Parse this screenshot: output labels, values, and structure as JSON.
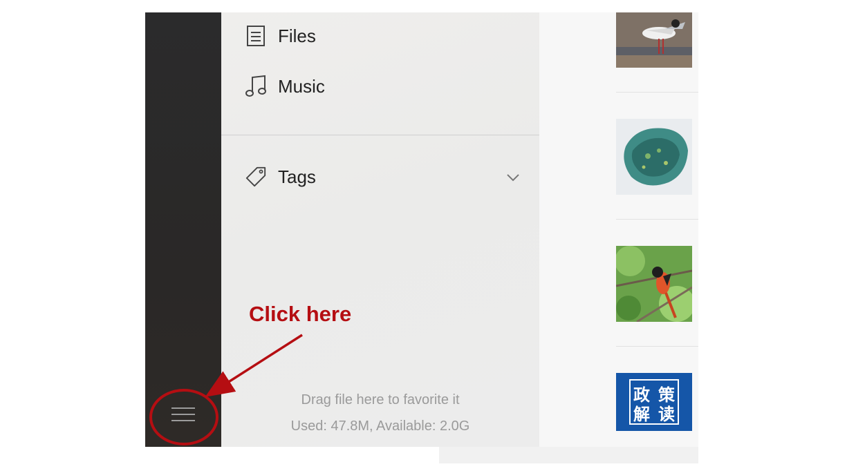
{
  "sidebar": {
    "menu_button_icon": "hamburger-icon"
  },
  "nav": {
    "items": [
      {
        "label": "Files",
        "icon": "document-icon"
      },
      {
        "label": "Music",
        "icon": "music-note-icon"
      }
    ],
    "tags": {
      "label": "Tags",
      "icon": "tag-icon",
      "expand_icon": "chevron-down-icon"
    }
  },
  "footer": {
    "hint": "Drag file here to favorite it",
    "storage": "Used: 47.8M, Available: 2.0G"
  },
  "thumbnails": [
    {
      "name": "gull-photo"
    },
    {
      "name": "island-map"
    },
    {
      "name": "redstart-bird-photo"
    },
    {
      "name": "policy-explainer-badge",
      "text": "政策解读",
      "chars": [
        "政",
        "策",
        "解",
        "读"
      ]
    }
  ],
  "annotation": {
    "text": "Click here",
    "color": "#b50e12"
  }
}
